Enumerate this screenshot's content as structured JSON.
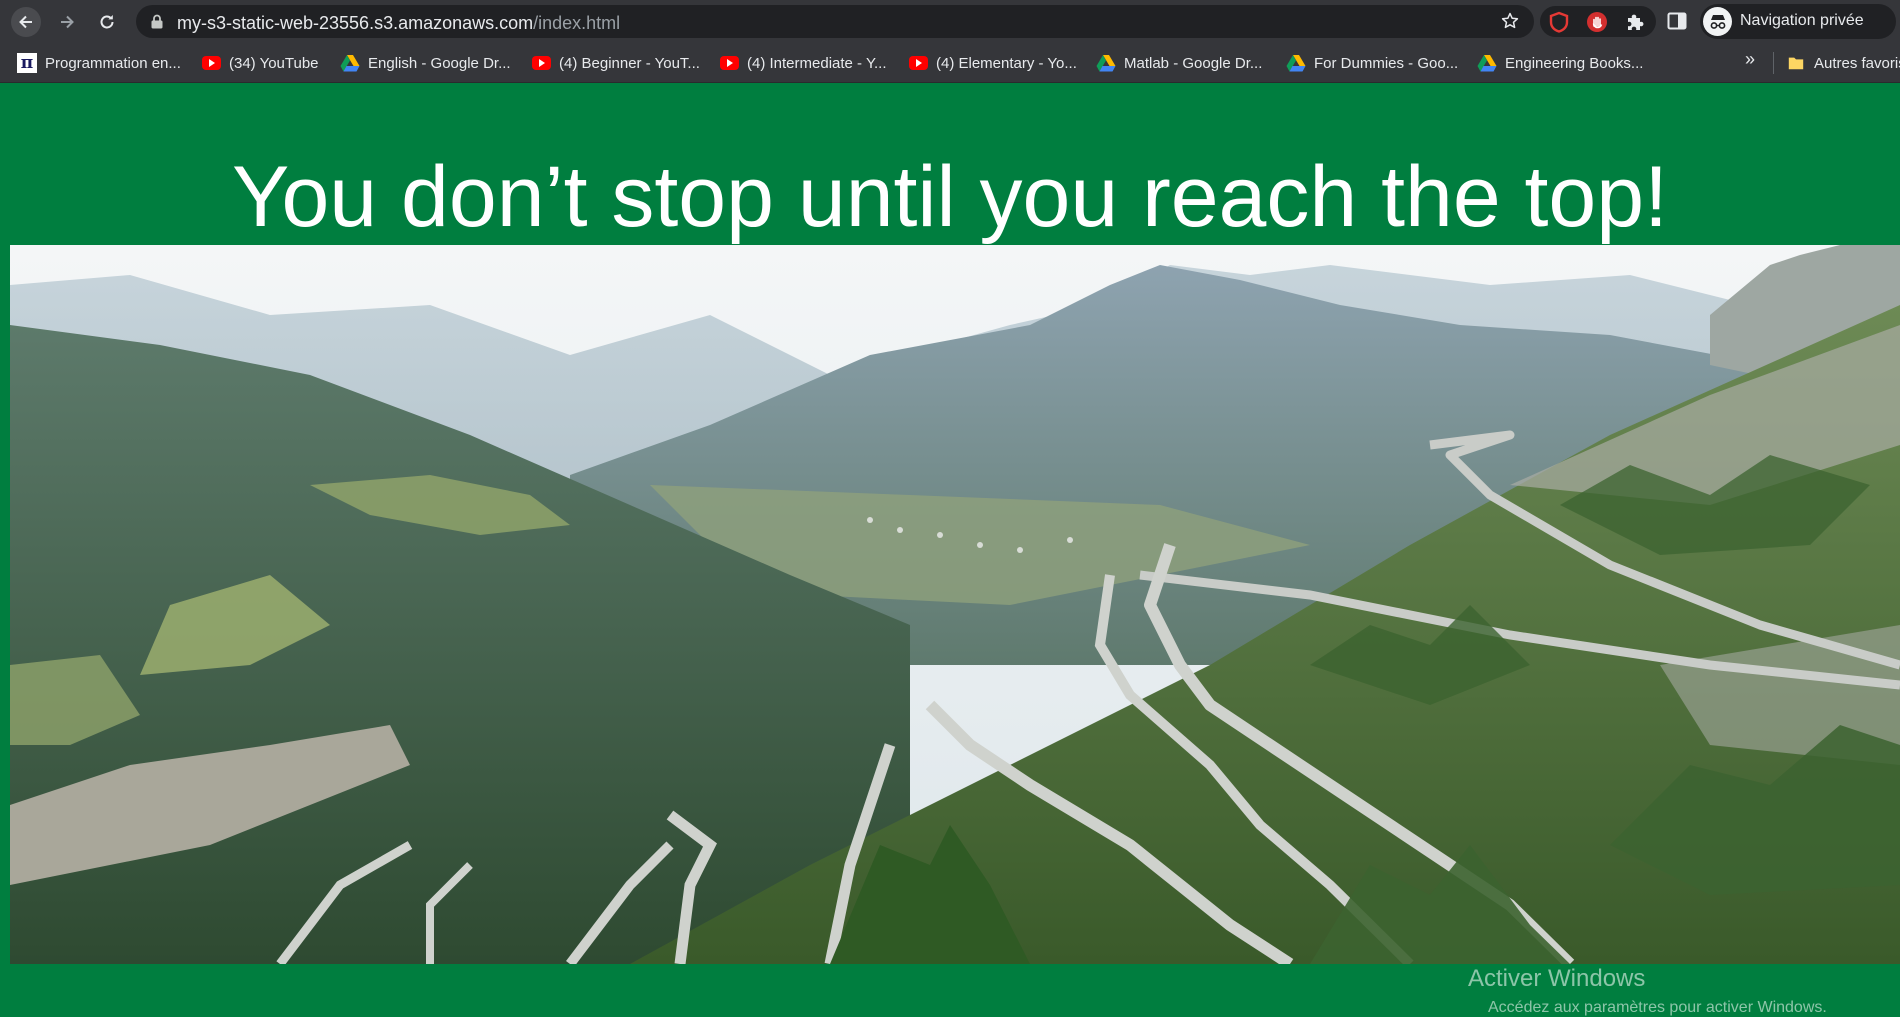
{
  "browser": {
    "url_host": "my-s3-static-web-23556.s3.amazonaws.com",
    "url_path": "/index.html",
    "profile_label": "Navigation privée"
  },
  "bookmarks": [
    {
      "label": "Programmation en...",
      "icon": "pi-icon"
    },
    {
      "label": "(34) YouTube",
      "icon": "youtube-icon"
    },
    {
      "label": "English - Google Dr...",
      "icon": "google-drive-icon"
    },
    {
      "label": "(4) Beginner - YouT...",
      "icon": "youtube-icon"
    },
    {
      "label": "(4) Intermediate - Y...",
      "icon": "youtube-icon"
    },
    {
      "label": "(4) Elementary - Yo...",
      "icon": "youtube-icon"
    },
    {
      "label": "Matlab - Google Dr...",
      "icon": "google-drive-icon"
    },
    {
      "label": "For Dummies - Goo...",
      "icon": "google-drive-icon"
    },
    {
      "label": "Engineering Books...",
      "icon": "google-drive-icon"
    }
  ],
  "bookmarks_more": "»",
  "other_bookmarks": "Autres favoris",
  "page": {
    "heading": "You don’t stop until you reach the top!",
    "image_subject": "winding mountain pass road in an alpine valley"
  },
  "watermark": {
    "line1": "Activer Windows",
    "line2": "Accédez aux paramètres pour activer Windows."
  },
  "colors": {
    "page_background": "#007e3f",
    "chrome_dark": "#35363a",
    "omnibox": "#202124"
  }
}
